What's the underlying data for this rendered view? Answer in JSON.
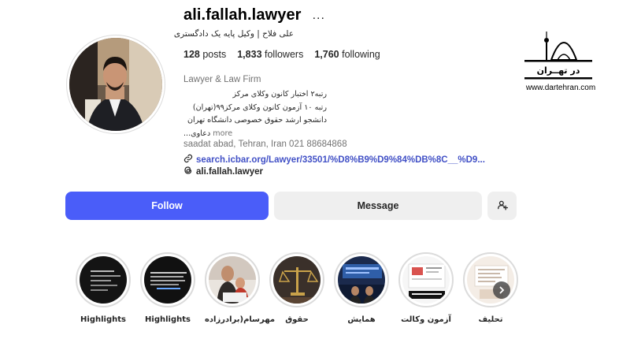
{
  "profile": {
    "username": "ali.fallah.lawyer",
    "more_icon": "...",
    "full_name": "علی فلاح | وکیل پایه یک دادگستری",
    "stats": {
      "posts_count": "128",
      "posts_label": "posts",
      "followers_count": "1,833",
      "followers_label": "followers",
      "following_count": "1,760",
      "following_label": "following"
    },
    "category": "Lawyer & Law Firm",
    "bio": {
      "line1": "رتبه۲ اختبار کانون وکلای مرکز",
      "line2": "رتبه ۱۰ آزمون کانون وکلای مرکز۹۹(تهران)",
      "line3": "دانشجو ارشد حقوق خصوصی دانشگاه تهران",
      "line4": "دعاوی...",
      "more": "more"
    },
    "address": "saadat abad, Tehran, Iran 021 88684868",
    "link": "search.icbar.org/Lawyer/33501/%D8%B9%D9%84%DB%8C__%D9...",
    "threads_handle": "ali.fallah.lawyer"
  },
  "actions": {
    "follow": "Follow",
    "message": "Message"
  },
  "highlights": [
    {
      "label": "Highlights"
    },
    {
      "label": "Highlights"
    },
    {
      "label": "مهرسام(برادرزاده"
    },
    {
      "label": "حقوق"
    },
    {
      "label": "همایش"
    },
    {
      "label": "آزمون وکالت"
    },
    {
      "label": "تحلیف"
    }
  ],
  "watermark": {
    "logo_text": "در تهــران",
    "url": "www.dartehran.com"
  },
  "icons": {
    "link": "link-icon",
    "threads": "threads-icon",
    "suggest": "add-person-icon",
    "next": "chevron-right-icon"
  },
  "colors": {
    "follow_button": "#4a5df9",
    "link_text": "#4150c6",
    "secondary_button": "#efefef"
  }
}
